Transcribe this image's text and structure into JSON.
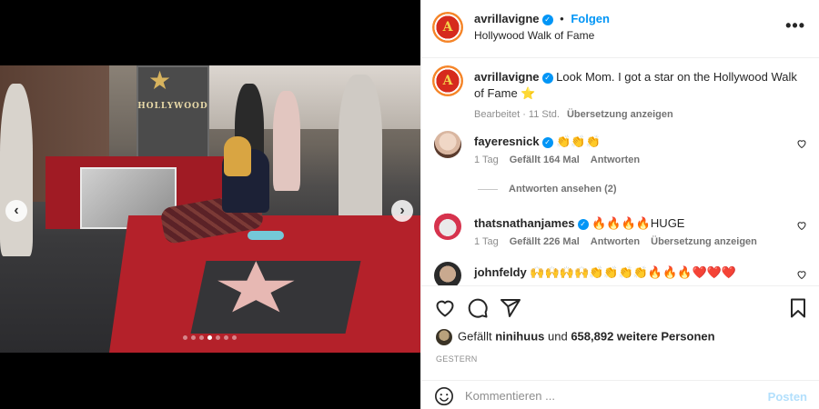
{
  "post": {
    "username": "avrillavigne",
    "follow_label": "Folgen",
    "separator": "•",
    "location": "Hollywood Walk of Fame",
    "more_label": "•••",
    "caption": {
      "username": "avrillavigne",
      "text": "Look Mom. I got a star on the Hollywood Walk of Fame ⭐",
      "edited": "Bearbeitet · 11 Std.",
      "translate": "Übersetzung anzeigen"
    },
    "media": {
      "sign_text": "HOLLYWOOD",
      "slide_count": 7,
      "active_slide": 4,
      "prev_label": "‹",
      "next_label": "›"
    }
  },
  "comments": [
    {
      "username": "fayeresnick",
      "text": "👏👏👏",
      "time": "1 Tag",
      "likes": "Gefällt 164 Mal",
      "reply": "Antworten",
      "translate": ""
    },
    {
      "username": "thatsnathanjames",
      "text": "🔥🔥🔥🔥HUGE",
      "time": "1 Tag",
      "likes": "Gefällt 226 Mal",
      "reply": "Antworten",
      "translate": "Übersetzung anzeigen"
    },
    {
      "username": "johnfeldy",
      "text": "🙌🙌🙌🙌👏👏👏👏🔥🔥🔥❤️❤️❤️",
      "time": "",
      "likes": "",
      "reply": "",
      "translate": ""
    }
  ],
  "view_replies": "Antworten ansehen (2)",
  "likes_summary": {
    "prefix": "Gefällt",
    "first_user": "ninihuus",
    "conjunction": "und",
    "others": "658,892 weitere Personen"
  },
  "date": "GESTERN",
  "comment_box": {
    "placeholder": "Kommentieren ...",
    "post_label": "Posten"
  },
  "colors": {
    "accent": "#0095f6",
    "post_disabled": "#b2dffc",
    "media_bg": "#000000"
  },
  "icons": {
    "like": "heart-icon",
    "comment": "comment-icon",
    "share": "share-icon",
    "save": "bookmark-icon",
    "emoji": "emoji-icon",
    "verified": "verified-badge-icon"
  }
}
